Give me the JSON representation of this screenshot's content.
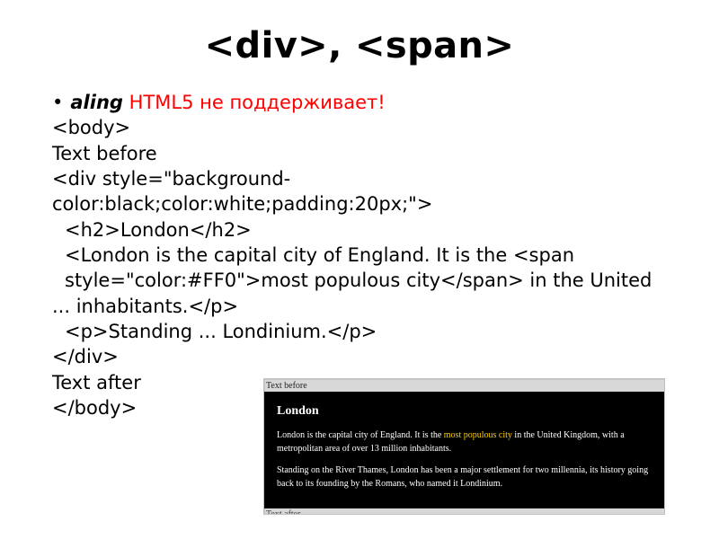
{
  "heading": "<div>, <span>",
  "bullet": {
    "attr": "aling",
    "note": "HTML5 не поддерживает!"
  },
  "code": {
    "l1": "<body>",
    "l2": "Text before",
    "l3": "<div style=\"background-color:black;color:white;padding:20px;\">",
    "l4": "<h2>London</h2>",
    "l5a": "<London is the capital city of England. It is the <span style=\"color:#FF0\">most populous city</span> in the United",
    "l5b": "... inhabitants.</p>",
    "l6": "<p>Standing ... Londinium.</p>",
    "l7": "</div>",
    "l8": "Text after",
    "l9": "</body>"
  },
  "shot": {
    "before": "Text before",
    "title": "London",
    "p1_a": "London is the capital city of England. It is the ",
    "p1_hl": "most populous city",
    "p1_b": " in the United Kingdom, with a metropolitan area of over 13 million inhabitants.",
    "p2": "Standing on the River Thames, London has been a major settlement for two millennia, its history going back to its founding by the Romans, who named it Londinium.",
    "after": "Text after"
  }
}
